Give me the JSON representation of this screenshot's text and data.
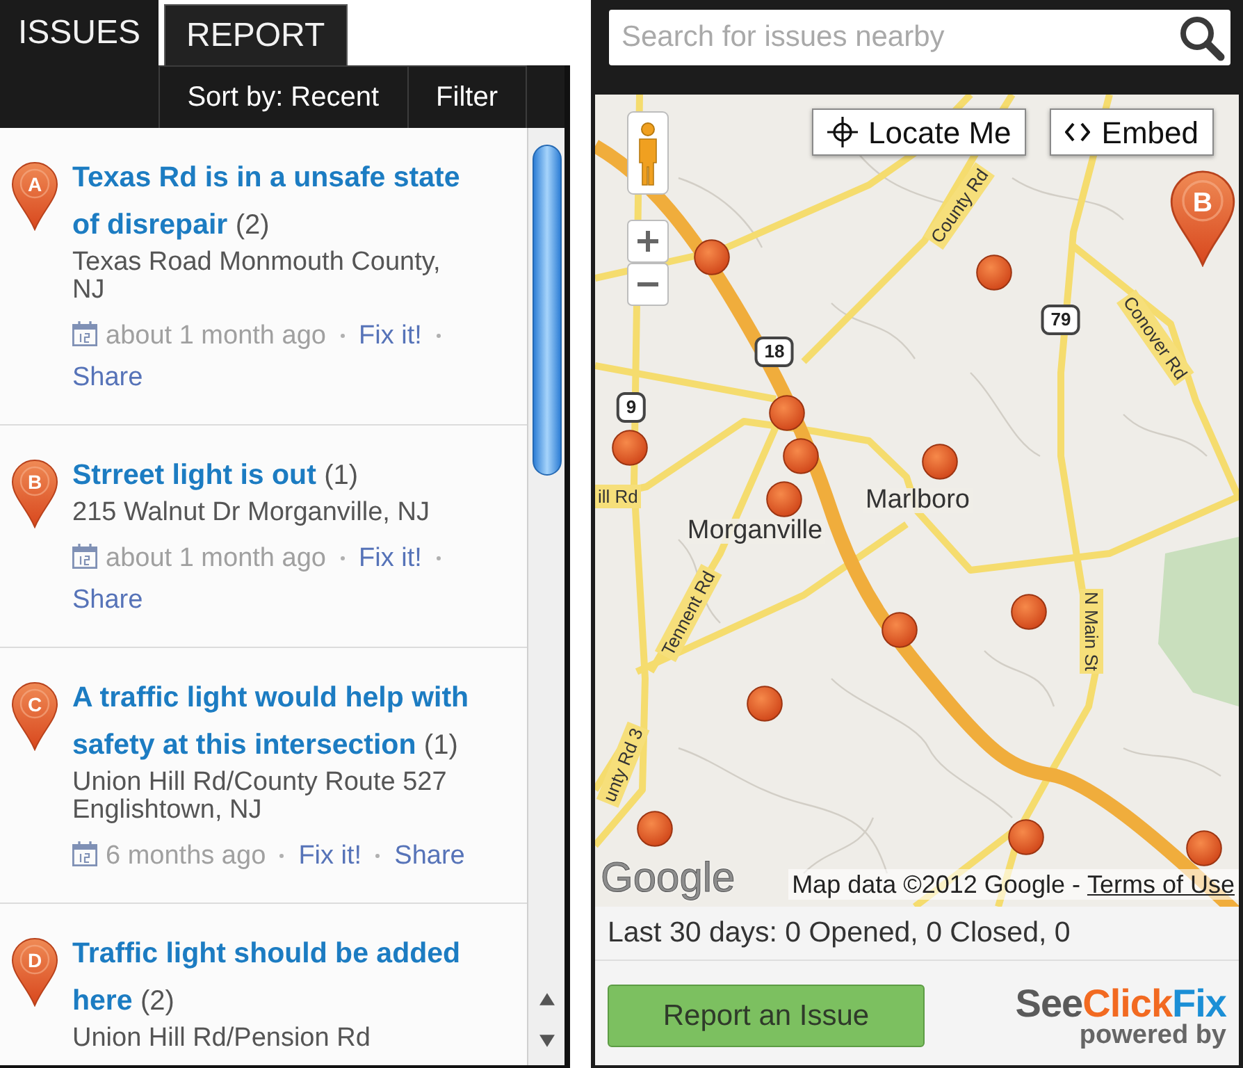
{
  "issues_panel": {
    "tabs": [
      {
        "label": "ISSUES",
        "selected": true
      },
      {
        "label": "REPORT",
        "selected": false
      }
    ],
    "toolbar": [
      "Sort by: Recent",
      "Filter"
    ],
    "issues": [
      {
        "pin": "A",
        "title": "Texas Rd is in a unsafe state of disrepair",
        "count": "(2)",
        "address": "Texas Road Monmouth County, NJ",
        "time": "about 1 month ago",
        "actions": [
          "Fix it!",
          "Share"
        ]
      },
      {
        "pin": "B",
        "title": "Strreet light is out",
        "count": "(1)",
        "address": "215 Walnut Dr Morganville, NJ",
        "time": "about 1 month ago",
        "actions": [
          "Fix it!",
          "Share"
        ]
      },
      {
        "pin": "C",
        "title": "A traffic light would help with safety at this intersection",
        "count": "(1)",
        "address": "Union Hill Rd/County Route 527 Englishtown, NJ",
        "time": "6 months ago",
        "actions": [
          "Fix it!",
          "Share"
        ]
      },
      {
        "pin": "D",
        "title": "Traffic light should be added here",
        "count": "(2)",
        "address": "Union Hill Rd/Pension Rd"
      }
    ]
  },
  "map_panel": {
    "search": {
      "placeholder": "Search for issues nearby"
    },
    "map": {
      "buttons": [
        {
          "label": "Locate Me",
          "kind": "locate"
        },
        {
          "label": "Embed",
          "kind": "embed"
        }
      ],
      "pins": [
        {
          "label": "B"
        }
      ],
      "labels": [
        {
          "text": "County Rd",
          "kind": "road"
        },
        {
          "text": "Conover Rd",
          "kind": "road"
        },
        {
          "text": "18",
          "kind": "shield"
        },
        {
          "text": "79",
          "kind": "shield"
        },
        {
          "text": "9",
          "kind": "shield"
        },
        {
          "text": "ill Rd",
          "kind": "road"
        },
        {
          "text": "Marlboro",
          "kind": "town"
        },
        {
          "text": "Morganville",
          "kind": "town"
        },
        {
          "text": "Tennent Rd",
          "kind": "road"
        },
        {
          "text": "N Main St",
          "kind": "road"
        },
        {
          "text": "unty Rd 3",
          "kind": "road"
        }
      ],
      "logo": "Google",
      "attribution": "Map data ©2012 Google -",
      "terms_link": "Terms of Use"
    },
    "stats": "Last 30 days: 0 Opened, 0 Closed, 0",
    "report_button": "Report an Issue",
    "brand": {
      "parts": [
        {
          "text": "See",
          "color": "#5a5a5a"
        },
        {
          "text": "Click",
          "color": "#f26a21"
        },
        {
          "text": "Fix",
          "color": "#1b8fd6"
        }
      ],
      "tagline": "powered by"
    }
  }
}
